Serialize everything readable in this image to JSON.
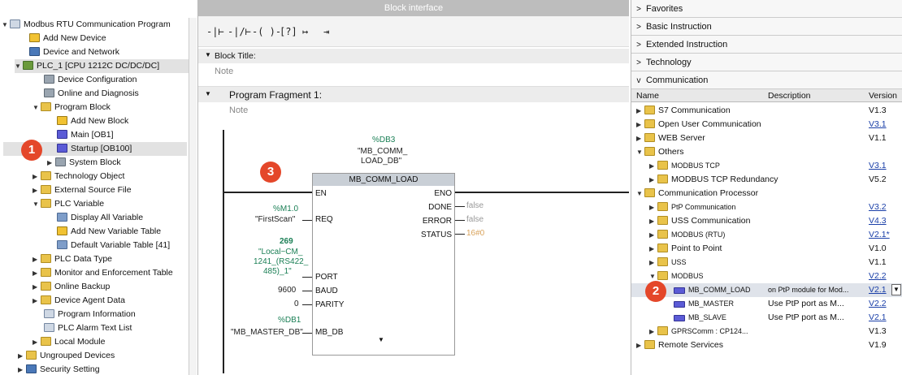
{
  "tree": {
    "root": "Modbus RTU Communication Program",
    "items": [
      "Add New Device",
      "Device and Network",
      "PLC_1 [CPU 1212C DC/DC/DC]",
      "Device Configuration",
      "Online and Diagnosis",
      "Program Block",
      "Add New Block",
      "Main [OB1]",
      "Startup [OB100]",
      "System Block",
      "Technology Object",
      "External Source File",
      "PLC Variable",
      "Display All Variable",
      "Add New Variable Table",
      "Default Variable Table [41]",
      "PLC Data Type",
      "Monitor and Enforcement Table",
      "Online Backup",
      "Device Agent Data",
      "Program Information",
      "PLC Alarm Text List",
      "Local Module",
      "Ungrouped Devices",
      "Security Setting"
    ]
  },
  "middle": {
    "header": "Block interface",
    "block_title_label": "Block Title:",
    "note1": "Note",
    "fragment_label": "Program Fragment 1:",
    "note2": "Note",
    "db_addr": "%DB3",
    "db_name_1": "\"MB_COMM_",
    "db_name_2": "LOAD_DB\"",
    "fb_title": "MB_COMM_LOAD",
    "pins_left": [
      "EN",
      "REQ",
      "PORT",
      "BAUD",
      "PARITY",
      "MB_DB"
    ],
    "pins_right": [
      "ENO",
      "DONE",
      "ERROR",
      "STATUS"
    ],
    "req_addr": "%M1.0",
    "req_name": "\"FirstScan\"",
    "port_value": "269",
    "port_name_1": "\"Local~CM_",
    "port_name_2": "1241_(RS422_",
    "port_name_3": "485)_1\"",
    "baud_value": "9600",
    "parity_value": "0",
    "mbdb_addr": "%DB1",
    "mbdb_name": "\"MB_MASTER_DB\"",
    "done_value": "false",
    "error_value": "false",
    "status_value": "16#0"
  },
  "right": {
    "categories": [
      "Favorites",
      "Basic Instruction",
      "Extended Instruction",
      "Technology",
      "Communication"
    ],
    "col_name": "Name",
    "col_desc": "Description",
    "col_ver": "Version",
    "rows": [
      {
        "name": "S7 Communication",
        "desc": "",
        "ver": "V1.3"
      },
      {
        "name": "Open User Communication",
        "desc": "",
        "ver": "V3.1"
      },
      {
        "name": "WEB Server",
        "desc": "",
        "ver": "V1.1"
      },
      {
        "name": "Others",
        "desc": "",
        "ver": ""
      },
      {
        "name": "MODBUS TCP",
        "desc": "",
        "ver": "V3.1"
      },
      {
        "name": "MODBUS TCP Redundancy",
        "desc": "",
        "ver": "V5.2"
      },
      {
        "name": "Communication Processor",
        "desc": "",
        "ver": ""
      },
      {
        "name": "PtP Communication",
        "desc": "",
        "ver": "V3.2"
      },
      {
        "name": "USS Communication",
        "desc": "",
        "ver": "V4.3"
      },
      {
        "name": "MODBUS (RTU)",
        "desc": "",
        "ver": "V2.1*"
      },
      {
        "name": "Point to Point",
        "desc": "",
        "ver": "V1.0"
      },
      {
        "name": "USS",
        "desc": "",
        "ver": "V1.1"
      },
      {
        "name": "MODBUS",
        "desc": "",
        "ver": "V2.2"
      },
      {
        "name": "MB_COMM_LOAD",
        "desc": "on PtP module for Mod...",
        "ver": "V2.1"
      },
      {
        "name": "MB_MASTER",
        "desc": "Use PtP port as M...",
        "ver": "V2.2"
      },
      {
        "name": "MB_SLAVE",
        "desc": "Use PtP port as M...",
        "ver": "V2.1"
      },
      {
        "name": "GPRSComm : CP124...",
        "desc": "",
        "ver": "V1.3"
      },
      {
        "name": "Remote Services",
        "desc": "",
        "ver": "V1.9"
      }
    ]
  },
  "badges": [
    "1",
    "2",
    "3"
  ]
}
